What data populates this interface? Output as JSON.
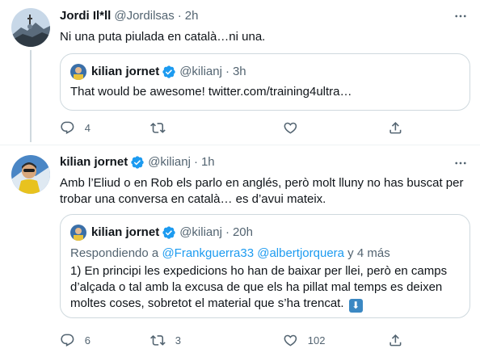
{
  "tweets": [
    {
      "author_name": "Jordi Il*ll",
      "author_handle": "@Jordilsas",
      "separator": "·",
      "time": "2h",
      "text": "Ni una puta piulada en català…ni una.",
      "quote": {
        "author_name": "kilian jornet",
        "author_handle": "@kilianj",
        "separator": "·",
        "time": "3h",
        "text": "That would be awesome! twitter.com/training4ultra…"
      },
      "actions": {
        "reply_count": "4",
        "retweet_count": "",
        "like_count": ""
      }
    },
    {
      "author_name": "kilian jornet",
      "author_handle": "@kilianj",
      "separator": "·",
      "time": "1h",
      "text": "Amb l’Eliud o en Rob els parlo en anglés, però molt lluny no has buscat per trobar una conversa en català… es d’avui mateix.",
      "quote": {
        "author_name": "kilian jornet",
        "author_handle": "@kilianj",
        "separator": "·",
        "time": "20h",
        "reply_prefix": "Respondiendo a ",
        "reply_mentions": "@Frankguerra33 @albertjorquera",
        "reply_suffix": " y 4 más",
        "text": "1) En principi les expedicions ho han de baixar per llei, però en camps d’alçada o tal amb la excusa de que els ha pillat mal temps es deixen moltes coses, sobretot el material que s’ha trencat.",
        "emoji": "⬇"
      },
      "actions": {
        "reply_count": "6",
        "retweet_count": "3",
        "like_count": "102"
      }
    }
  ],
  "icons": {
    "verified": "verified-badge-icon",
    "more": "more-dots-icon",
    "reply": "reply-icon",
    "retweet": "retweet-icon",
    "like": "like-icon",
    "share": "share-icon"
  },
  "colors": {
    "text": "#0f1419",
    "muted": "#536471",
    "accent": "#1d9bf0",
    "border": "#cfd9de",
    "thread_line": "#cfd9de"
  }
}
